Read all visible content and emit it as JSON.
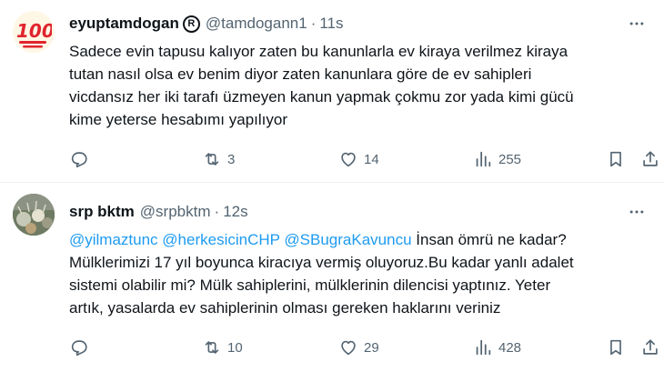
{
  "tweets": [
    {
      "avatar": {
        "glyph": "💯",
        "icon": "hundred-points-emoji"
      },
      "author_name": "eyuptamdogan",
      "badge_glyph": "R",
      "handle": "@tamdogann1",
      "separator": "·",
      "time": "11s",
      "text_lines": [
        "Sadece evin tapusu kalıyor zaten bu kanunlarla ev kiraya verilmez kiraya",
        "tutan nasıl olsa ev benim diyor zaten kanunlara göre de ev sahipleri",
        "vicdansız her iki tarafı üzmeyen kanun yapmak çokmu zor yada kimi gücü",
        "kime yeterse hesabımı yapılıyor"
      ],
      "stats": {
        "retweets": "3",
        "likes": "14",
        "views": "255"
      }
    },
    {
      "avatar": {
        "icon": "photo-avatar"
      },
      "author_name": "srp bktm",
      "handle": "@srpbktm",
      "separator": "·",
      "time": "12s",
      "mentions": [
        "@yilmaztunc",
        "@herkesicinCHP",
        "@SBugraKavuncu"
      ],
      "text_first_rest": " İnsan ömrü ne kadar?",
      "text_lines": [
        "Mülklerimizi 17 yıl boyunca kiracıya vermiş oluyoruz.Bu kadar yanlı adalet",
        "sistemi olabilir mi? Mülk sahiplerini, mülklerinin dilencisi yaptınız. Yeter",
        "artık, yasalarda ev sahiplerinin olması gereken haklarını veriniz"
      ],
      "stats": {
        "retweets": "10",
        "likes": "29",
        "views": "428"
      }
    }
  ],
  "colors": {
    "accent": "#1d9bf0",
    "muted": "#536471",
    "text": "#0f1419",
    "divider": "#eff3f4"
  }
}
